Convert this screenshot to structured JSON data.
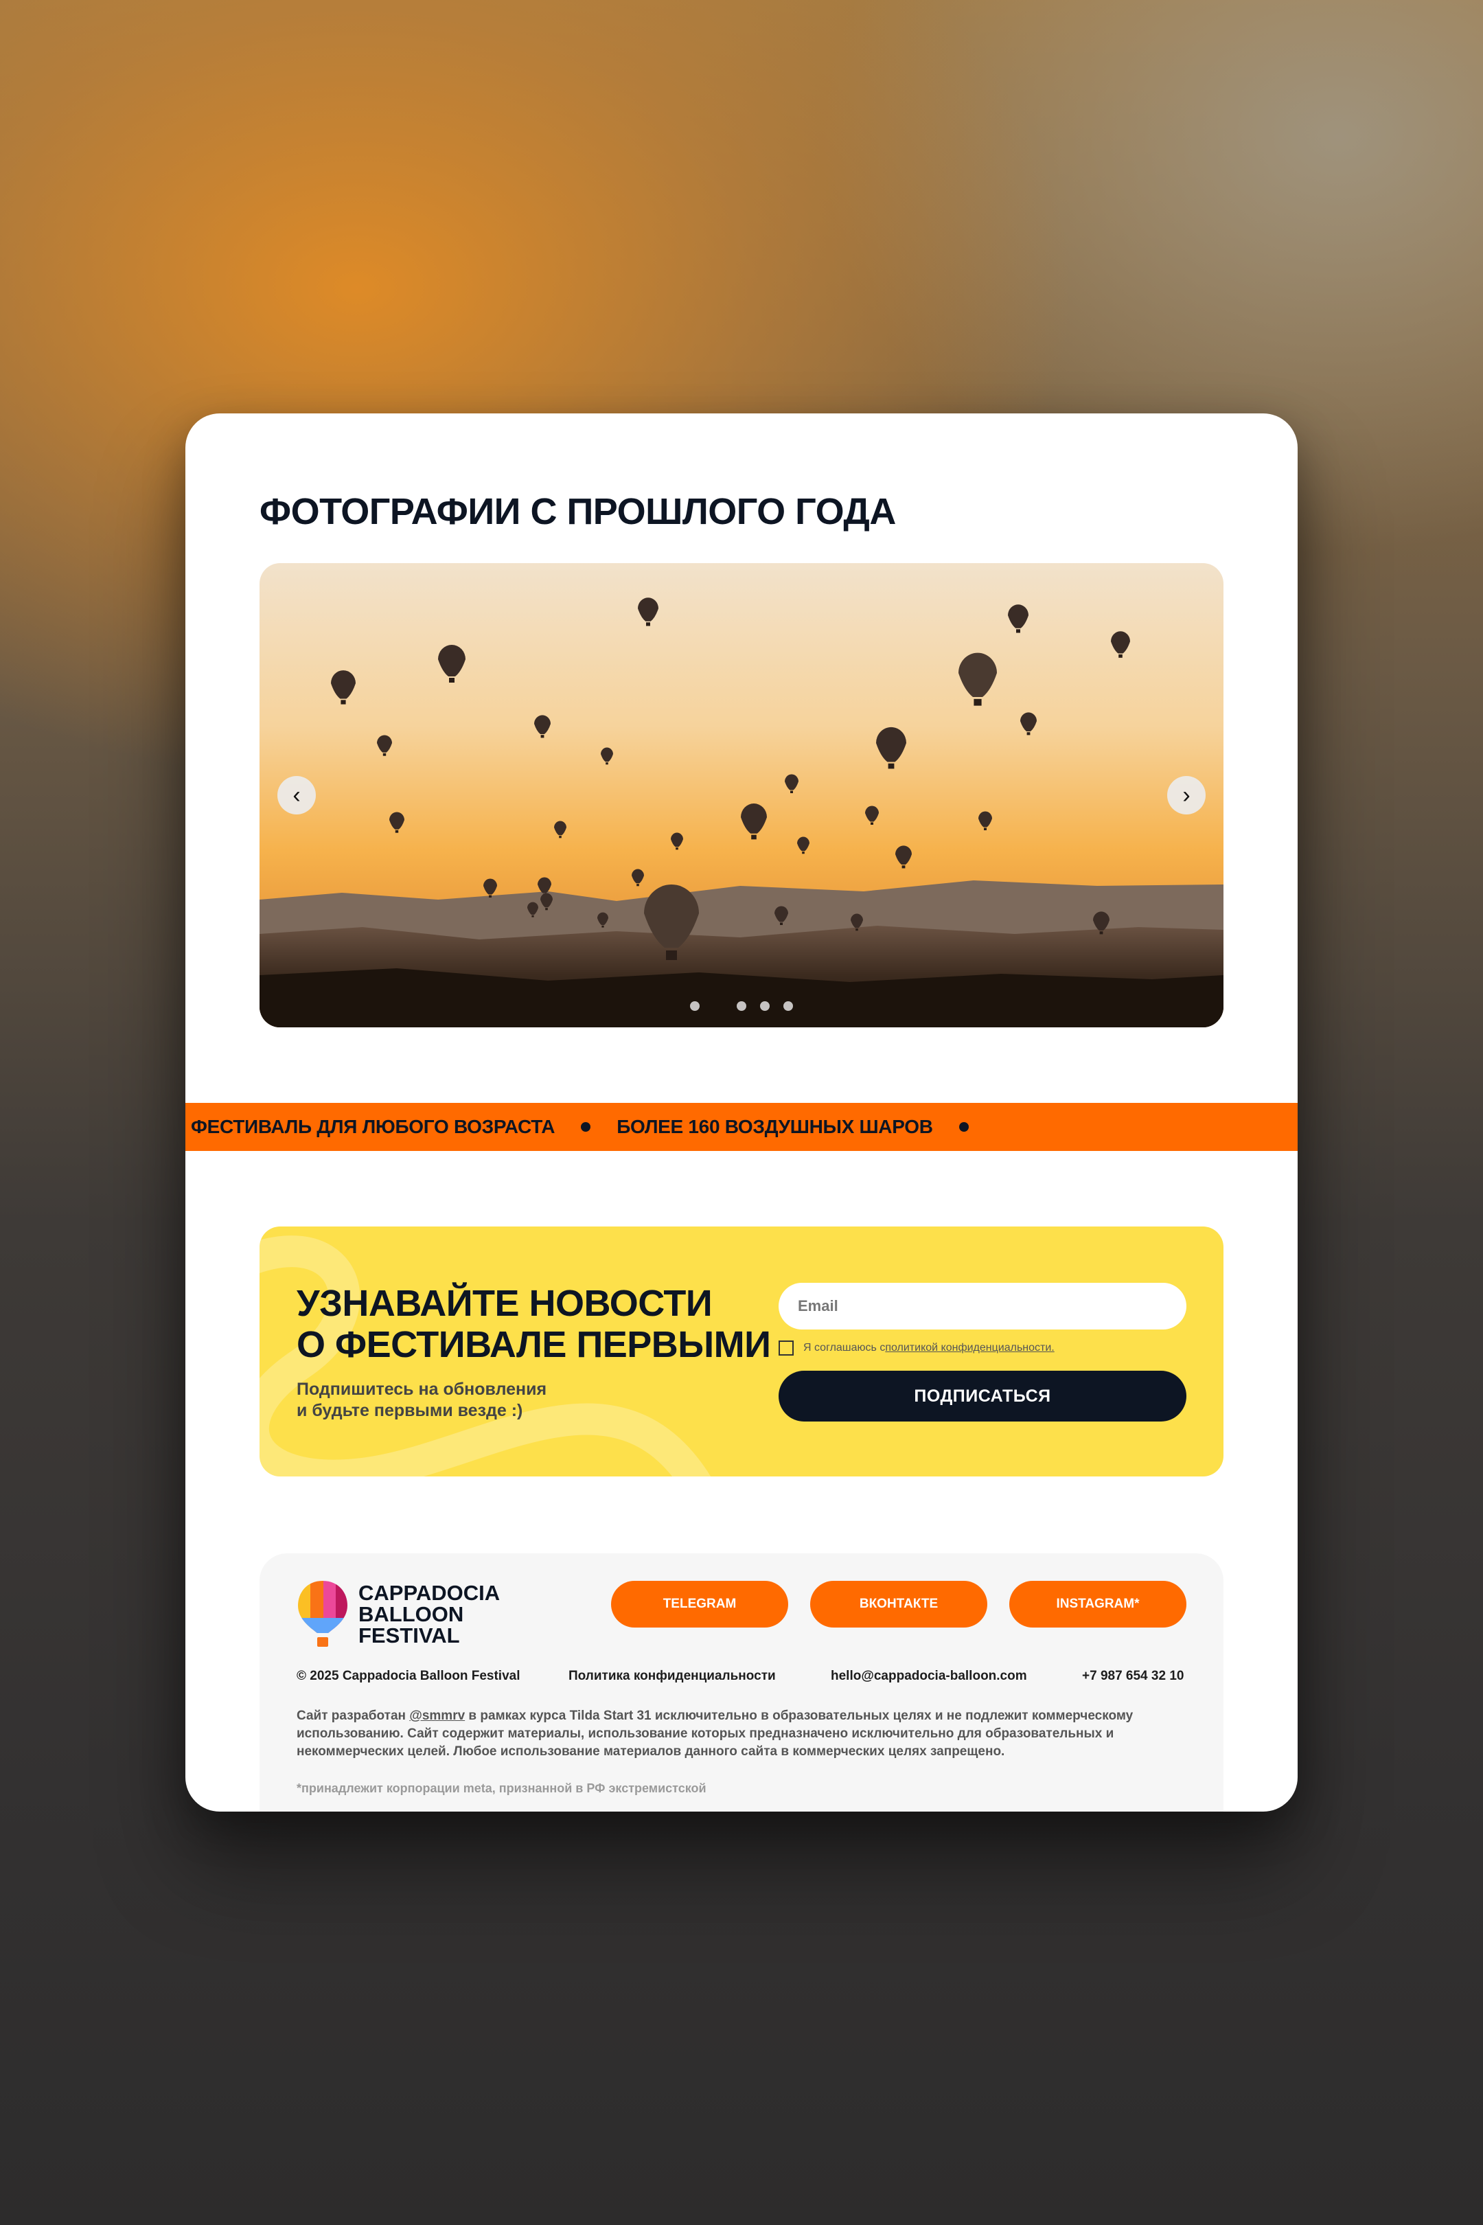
{
  "gallery": {
    "title": "ФОТОГРАФИИ С ПРОШЛОГО ГОДА",
    "prev_icon": "‹",
    "next_icon": "›",
    "slide_count": 5,
    "active_slide": 1
  },
  "marquee": {
    "items": [
      "ФЕСТИВАЛЬ ДЛЯ ЛЮБОГО ВОЗРАСТА",
      "БОЛЕЕ 160 ВОЗДУШНЫХ ШАРОВ"
    ],
    "color": "#ff6a00"
  },
  "subscribe": {
    "title_line1": "УЗНАВАЙТЕ НОВОСТИ",
    "title_line2": "О ФЕСТИВАЛЕ ПЕРВЫМИ",
    "text_line1": "Подпишитесь на обновления",
    "text_line2": "и будьте первыми везде :)",
    "email_placeholder": "Email",
    "email_value": "",
    "consent_text": "Я соглашаюсь с ",
    "consent_link": "политикой конфиденциальности.",
    "consent_checked": false,
    "button_label": "ПОДПИСАТЬСЯ",
    "bg_color": "#fde04b"
  },
  "footer": {
    "logo_line1": "CAPPADOCIA",
    "logo_line2": "BALLOON",
    "logo_line3": "FESTIVAL",
    "social": [
      "TELEGRAM",
      "ВКОНТАКТЕ",
      "INSTAGRAM*"
    ],
    "copyright": "© 2025 Cappadocia Balloon Festival",
    "privacy": "Политика конфиденциальности",
    "email": "hello@cappadocia-balloon.com",
    "phone": "+7 987 654 32 10",
    "note_prefix": "Сайт разработан ",
    "note_handle": "@smmrv",
    "note_rest": " в рамках курса Tilda Start 31 исключительно в образовательных целях и не подлежит коммерческому использованию. Сайт содержит материалы, использование которых предназначено исключительно для образовательных и некоммерческих целей. Любое использование материалов данного сайта в коммерческих целях запрещено.",
    "meta_note": "*принадлежит корпорации meta, признанной в РФ экстремистской"
  },
  "colors": {
    "accent": "#ff6a00",
    "dark": "#0d1523",
    "yellow": "#fde04b"
  }
}
